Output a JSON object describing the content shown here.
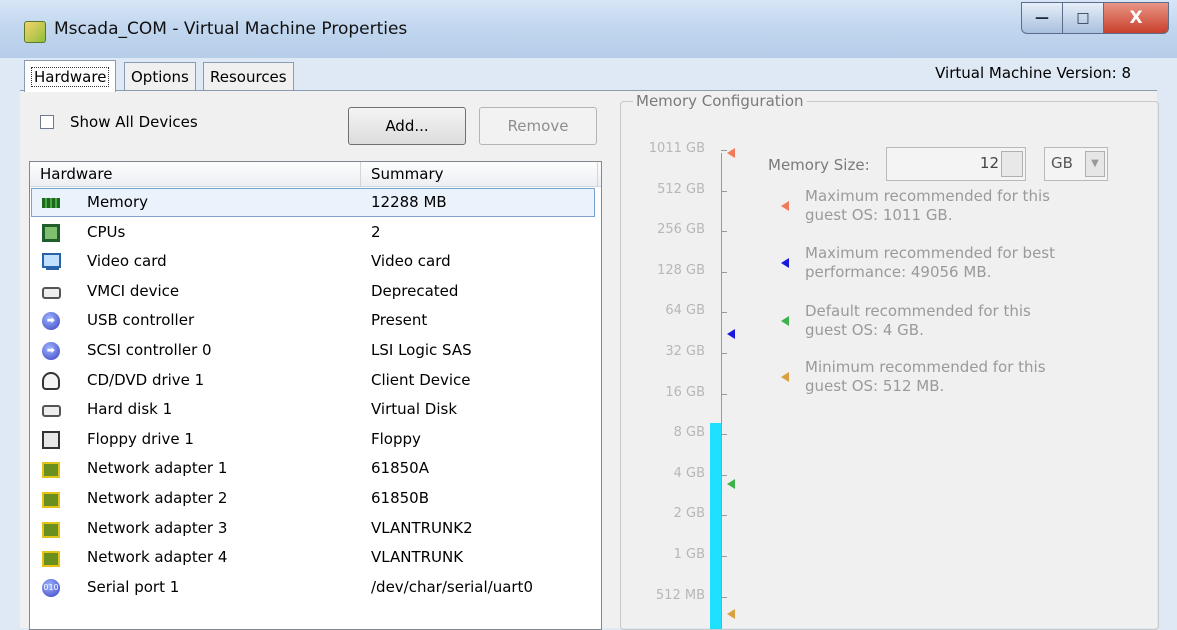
{
  "window": {
    "title": "Mscada_COM - Virtual Machine Properties",
    "minimize": "—",
    "maximize": "□",
    "close": "X"
  },
  "tabs": [
    {
      "label": "Hardware",
      "active": true
    },
    {
      "label": "Options",
      "active": false
    },
    {
      "label": "Resources",
      "active": false
    }
  ],
  "vm_version": "Virtual Machine Version: 8",
  "toolbar": {
    "show_all_devices": "Show All Devices",
    "show_all_devices_checked": false,
    "add_label": "Add...",
    "remove_label": "Remove"
  },
  "hardware_table": {
    "columns": [
      "Hardware",
      "Summary"
    ],
    "rows": [
      {
        "icon": "memory-icon",
        "name": "Memory",
        "summary": "12288 MB",
        "selected": true
      },
      {
        "icon": "cpu-icon",
        "name": "CPUs",
        "summary": "2"
      },
      {
        "icon": "video-card-icon",
        "name": "Video card",
        "summary": "Video card"
      },
      {
        "icon": "vmci-device-icon",
        "name": "VMCI device",
        "summary": "Deprecated"
      },
      {
        "icon": "usb-controller-icon",
        "name": "USB controller",
        "summary": "Present"
      },
      {
        "icon": "scsi-controller-icon",
        "name": "SCSI controller 0",
        "summary": "LSI Logic SAS"
      },
      {
        "icon": "cd-dvd-drive-icon",
        "name": "CD/DVD drive 1",
        "summary": "Client Device"
      },
      {
        "icon": "hard-disk-icon",
        "name": "Hard disk 1",
        "summary": "Virtual Disk"
      },
      {
        "icon": "floppy-drive-icon",
        "name": "Floppy drive 1",
        "summary": "Floppy"
      },
      {
        "icon": "network-adapter-icon",
        "name": "Network adapter 1",
        "summary": "61850A"
      },
      {
        "icon": "network-adapter-icon",
        "name": "Network adapter 2",
        "summary": "61850B"
      },
      {
        "icon": "network-adapter-icon",
        "name": "Network adapter 3",
        "summary": "VLANTRUNK2"
      },
      {
        "icon": "network-adapter-icon",
        "name": "Network adapter 4",
        "summary": "VLANTRUNK"
      },
      {
        "icon": "serial-port-icon",
        "name": "Serial port 1",
        "summary": "/dev/char/serial/uart0"
      }
    ]
  },
  "memory_config": {
    "legend": "Memory Configuration",
    "size_label": "Memory Size:",
    "size_value": "12",
    "unit": "GB",
    "scale_labels": [
      "1011 GB",
      "512 GB",
      "256 GB",
      "128 GB",
      "64 GB",
      "32 GB",
      "16 GB",
      "8 GB",
      "4 GB",
      "2 GB",
      "1 GB",
      "512 MB"
    ],
    "recommendations": [
      {
        "line1": "Maximum recommended for this",
        "line2": "guest OS: 1011 GB.",
        "color": "#f07a5a"
      },
      {
        "line1": "Maximum recommended for best",
        "line2": "performance: 49056 MB.",
        "color": "#1a1adf"
      },
      {
        "line1": "Default recommended for this",
        "line2": "guest OS: 4 GB.",
        "color": "#3cb44b"
      },
      {
        "line1": "Minimum recommended for this",
        "line2": "guest OS: 512 MB.",
        "color": "#d9a041"
      }
    ],
    "fill_color": "#1fe0ff"
  }
}
